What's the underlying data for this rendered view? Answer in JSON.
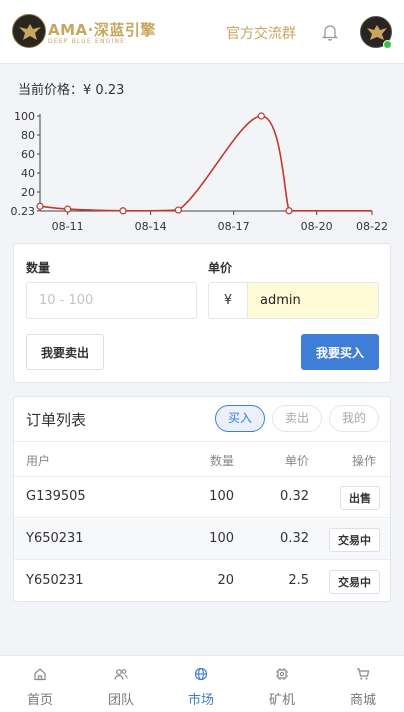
{
  "header": {
    "brand": "AMA·深蓝引擎",
    "brand_sub": "DEEP BLUE ENGINE",
    "group_link": "官方交流群",
    "icons": {
      "logo": "eagle-logo",
      "bell": "bell-icon",
      "avatar": "eagle-avatar"
    },
    "online_color": "#3bbf4a"
  },
  "price": {
    "label": "当前价格：",
    "value": "¥ 0.23"
  },
  "chart_data": {
    "type": "line",
    "title": "",
    "xlabel": "",
    "ylabel": "",
    "x_ticks": [
      "08-11",
      "08-14",
      "08-17",
      "08-20",
      "08-22"
    ],
    "y_ticks": [
      "0.23",
      "20",
      "40",
      "60",
      "80",
      "100"
    ],
    "ylim": [
      0,
      100
    ],
    "xlim": [
      "08-10",
      "08-22"
    ],
    "series": [
      {
        "color": "#c0392b",
        "points": [
          {
            "x": "08-10",
            "y": 5
          },
          {
            "x": "08-11",
            "y": 2
          },
          {
            "x": "08-13",
            "y": 0.23
          },
          {
            "x": "08-15",
            "y": 1
          },
          {
            "x": "08-18",
            "y": 100
          },
          {
            "x": "08-19",
            "y": 0.23
          }
        ],
        "tail": {
          "x": "08-22",
          "y": 0.23
        }
      }
    ],
    "grid": false
  },
  "trade": {
    "qty_label": "数量",
    "qty_placeholder": "10 - 100",
    "price_label": "单价",
    "currency": "¥",
    "price_value": "admin",
    "sell_label": "我要卖出",
    "buy_label": "我要买入"
  },
  "orders": {
    "title": "订单列表",
    "filters": [
      "买入",
      "卖出",
      "我的"
    ],
    "columns": {
      "user": "用户",
      "qty": "数量",
      "price": "单价",
      "action": "操作"
    },
    "rows": [
      {
        "user": "G139505",
        "qty": "100",
        "price": "0.32",
        "action": "出售"
      },
      {
        "user": "Y650231",
        "qty": "100",
        "price": "0.32",
        "action": "交易中"
      },
      {
        "user": "Y650231",
        "qty": "20",
        "price": "2.5",
        "action": "交易中"
      }
    ]
  },
  "tabbar": {
    "items": [
      {
        "label": "首页",
        "icon": "home-icon"
      },
      {
        "label": "团队",
        "icon": "team-icon"
      },
      {
        "label": "市场",
        "icon": "globe-icon"
      },
      {
        "label": "矿机",
        "icon": "chip-icon"
      },
      {
        "label": "商城",
        "icon": "cart-icon"
      }
    ],
    "active_index": 2,
    "active_color": "#3f7ed6"
  }
}
